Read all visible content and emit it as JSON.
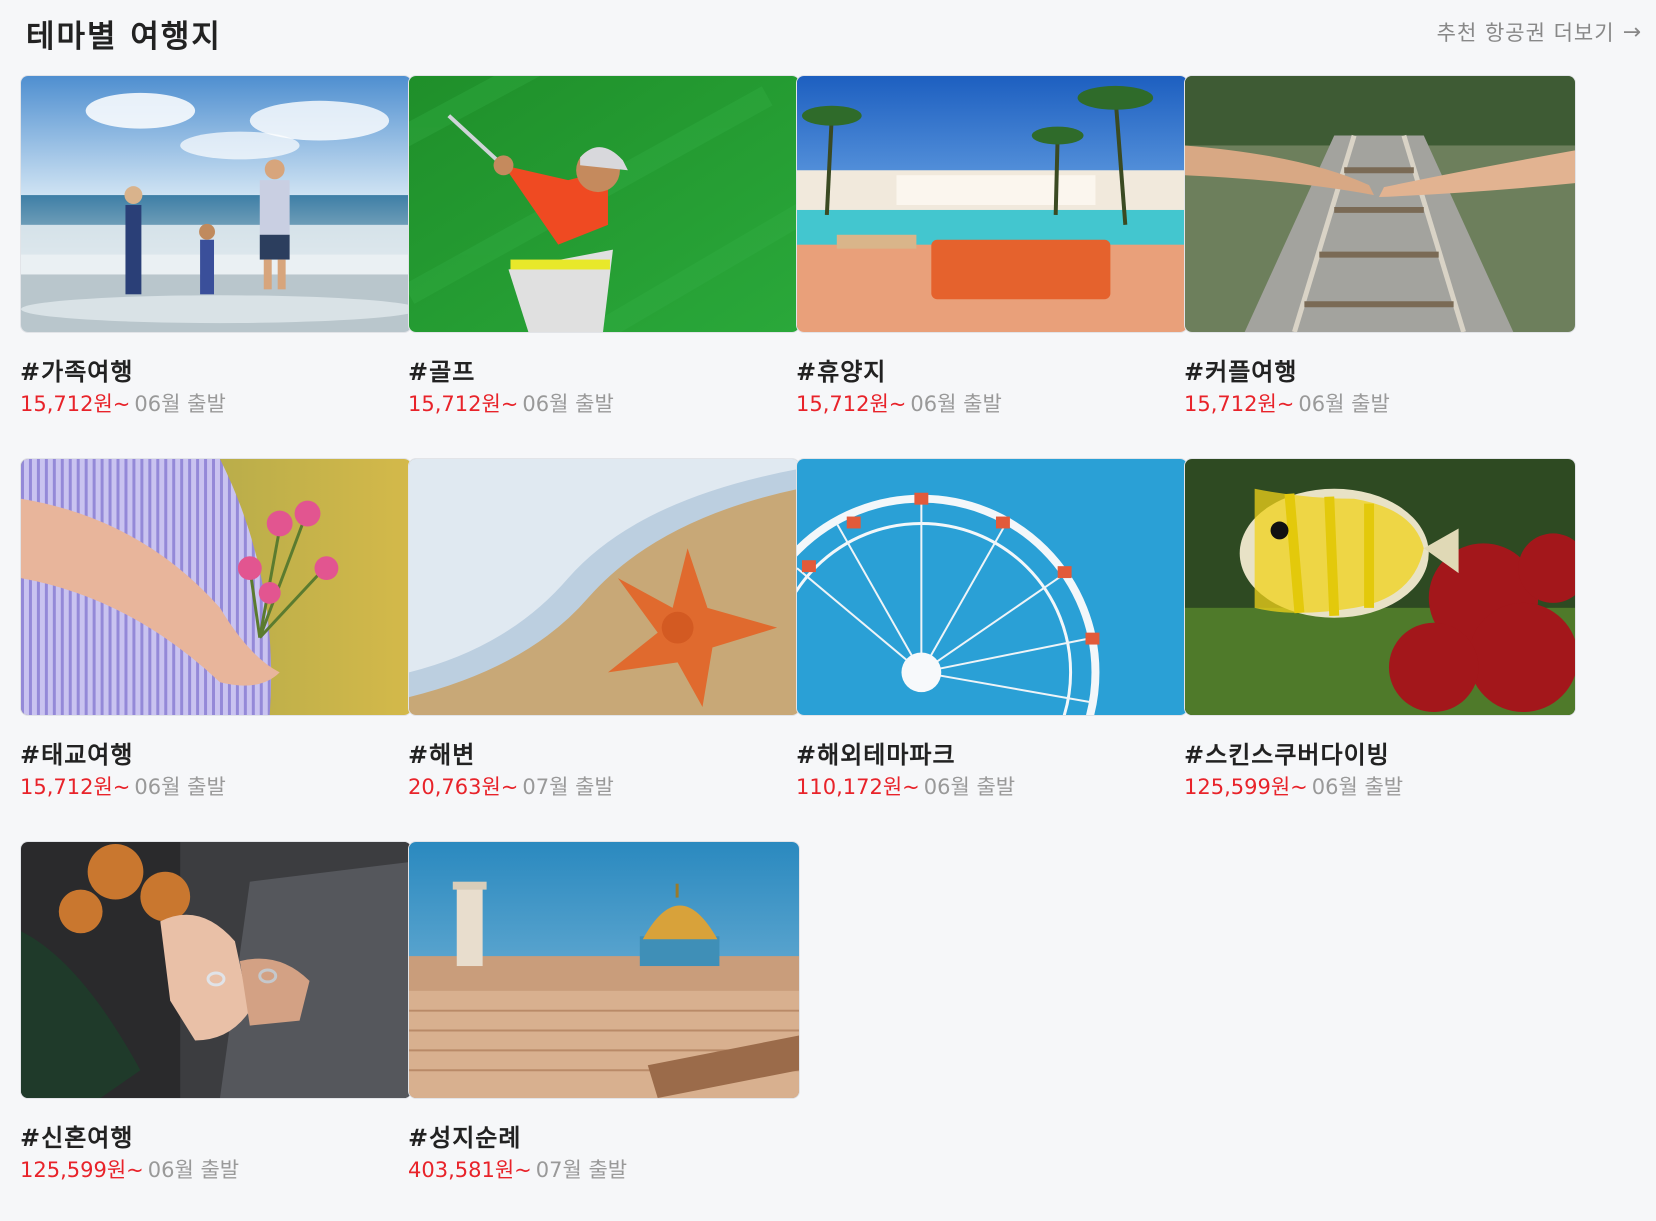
{
  "header": {
    "title": "테마별 여행지",
    "more_label": "추천 항공권 더보기",
    "more_arrow": "→"
  },
  "cards": [
    {
      "tag": "#가족여행",
      "price": "15,712원~",
      "depart": "06월 출발",
      "image": "family-beach-photo"
    },
    {
      "tag": "#골프",
      "price": "15,712원~",
      "depart": "06월 출발",
      "image": "golfer-swing-photo"
    },
    {
      "tag": "#휴양지",
      "price": "15,712원~",
      "depart": "06월 출발",
      "image": "resort-pool-palms-photo"
    },
    {
      "tag": "#커플여행",
      "price": "15,712원~",
      "depart": "06월 출발",
      "image": "couple-hands-railway-photo"
    },
    {
      "tag": "#태교여행",
      "price": "15,712원~",
      "depart": "06월 출발",
      "image": "pregnant-flowers-photo"
    },
    {
      "tag": "#해변",
      "price": "20,763원~",
      "depart": "07월 출발",
      "image": "starfish-beach-photo"
    },
    {
      "tag": "#해외테마파크",
      "price": "110,172원~",
      "depart": "06월 출발",
      "image": "ferris-wheel-photo"
    },
    {
      "tag": "#스킨스쿠버다이빙",
      "price": "125,599원~",
      "depart": "06월 출발",
      "image": "butterflyfish-reef-photo"
    },
    {
      "tag": "#신혼여행",
      "price": "125,599원~",
      "depart": "06월 출발",
      "image": "wedding-rings-hands-photo"
    },
    {
      "tag": "#성지순례",
      "price": "403,581원~",
      "depart": "07월 출발",
      "image": "jerusalem-dome-photo"
    }
  ],
  "colors": {
    "background": "#f6f7f9",
    "price": "#e8232a",
    "muted": "#999999",
    "title": "#222222"
  }
}
